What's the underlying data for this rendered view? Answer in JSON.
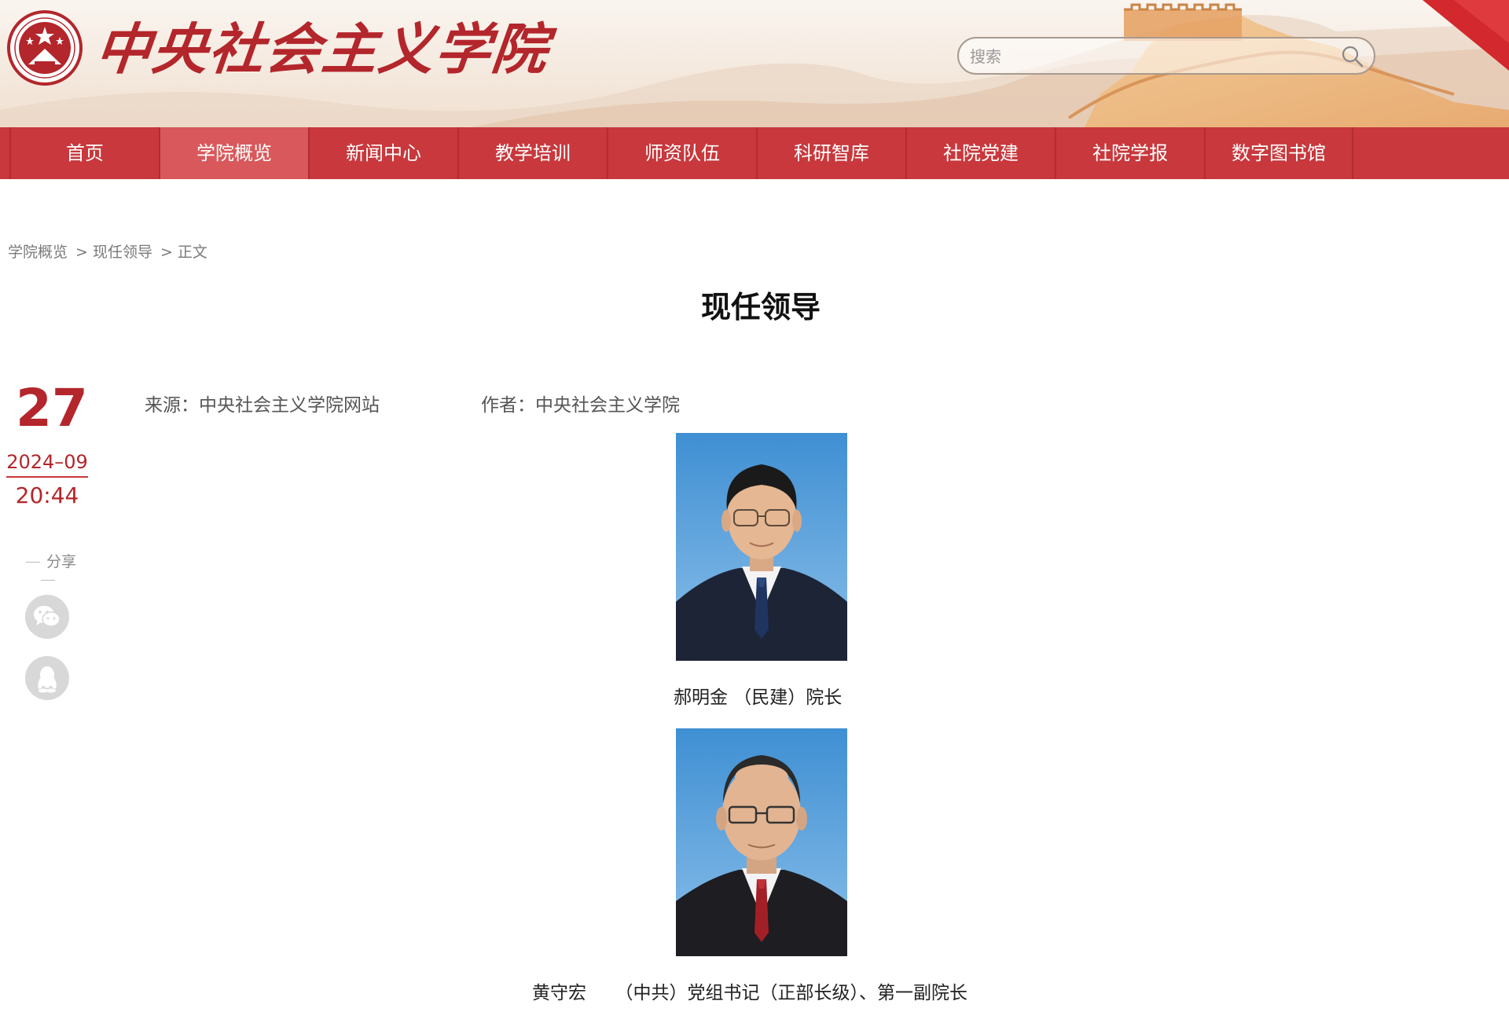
{
  "header": {
    "logo_text": "中央社会主义学院",
    "search": {
      "placeholder": "搜索"
    }
  },
  "nav": {
    "items": [
      "首页",
      "学院概览",
      "新闻中心",
      "教学培训",
      "师资队伍",
      "科研智库",
      "社院党建",
      "社院学报",
      "数字图书馆"
    ],
    "active": "学院概览"
  },
  "breadcrumb": {
    "items": [
      "学院概览",
      "现任领导",
      "正文"
    ],
    "separator": ">"
  },
  "article": {
    "title": "现任领导",
    "date": {
      "day": "27",
      "year_month": "2024–09",
      "time": "20:44"
    },
    "source": "来源：中央社会主义学院网站",
    "author": "作者：中央社会主义学院"
  },
  "share": {
    "label": "分享",
    "buttons": [
      "wechat-icon",
      "qq-icon"
    ]
  },
  "leaders": [
    {
      "caption": "郝明金 （民建）院长"
    },
    {
      "caption": "黄守宏     （中共）党组书记（正部长级）、第一副院长"
    }
  ],
  "colors": {
    "brand_red": "#b3262b",
    "nav_red": "#c8383c",
    "nav_active": "#d8585b"
  }
}
